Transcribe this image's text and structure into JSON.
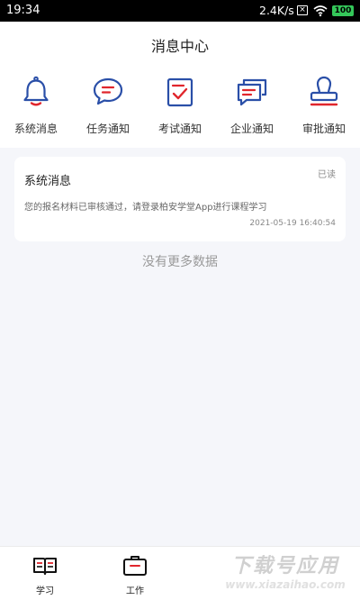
{
  "status_bar": {
    "time": "19:34",
    "net_speed": "2.4K/s",
    "sim_icon": "no-sim-icon",
    "wifi_icon": "wifi-icon",
    "battery": "100"
  },
  "header": {
    "title": "消息中心"
  },
  "categories": [
    {
      "label": "系统消息",
      "icon": "bell-icon"
    },
    {
      "label": "任务通知",
      "icon": "chat-bubble-icon"
    },
    {
      "label": "考试通知",
      "icon": "checklist-icon"
    },
    {
      "label": "企业通知",
      "icon": "double-chat-icon"
    },
    {
      "label": "审批通知",
      "icon": "stamp-icon"
    }
  ],
  "messages": [
    {
      "title": "系统消息",
      "status": "已读",
      "body": "您的报名材料已审核通过，请登录柏安学堂App进行课程学习",
      "time": "2021-05-19 16:40:54"
    }
  ],
  "list_footer": "没有更多数据",
  "bottom_nav": [
    {
      "label": "学习",
      "icon": "open-book-icon"
    },
    {
      "label": "工作",
      "icon": "briefcase-icon"
    }
  ],
  "watermark": {
    "main": "下载号应用",
    "url": "www.xiazaihao.com"
  },
  "colors": {
    "primary_blue": "#2a4fa8",
    "accent_red": "#e0262c",
    "background": "#f5f6fa"
  }
}
